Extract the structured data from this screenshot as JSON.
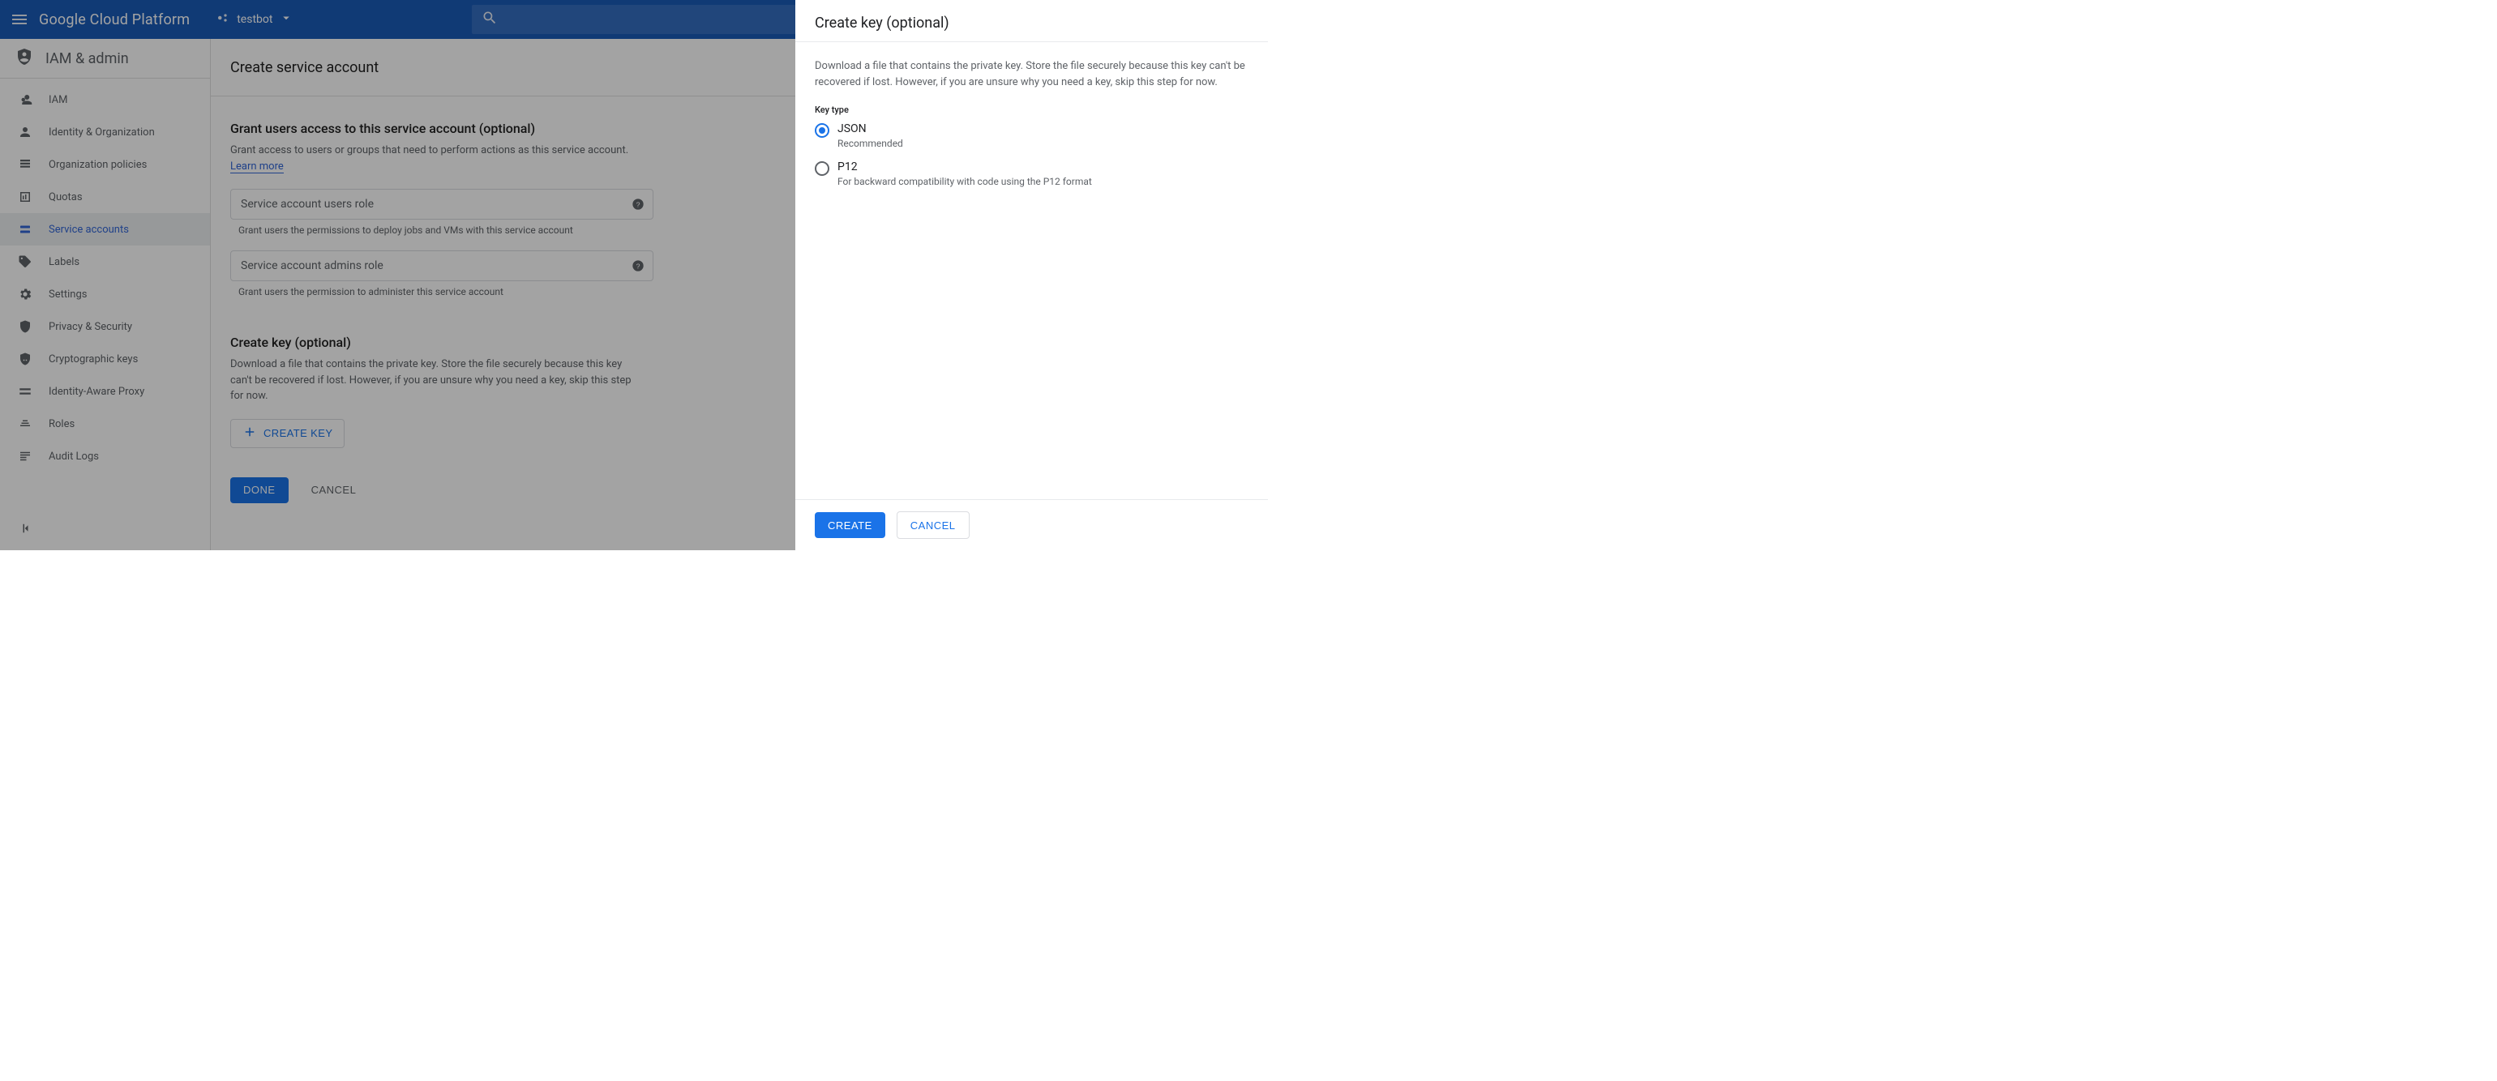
{
  "brand": "Google Cloud Platform",
  "project": {
    "name": "testbot"
  },
  "section": {
    "title": "IAM & admin"
  },
  "nav": {
    "items": [
      {
        "label": "IAM"
      },
      {
        "label": "Identity & Organization"
      },
      {
        "label": "Organization policies"
      },
      {
        "label": "Quotas"
      },
      {
        "label": "Service accounts"
      },
      {
        "label": "Labels"
      },
      {
        "label": "Settings"
      },
      {
        "label": "Privacy & Security"
      },
      {
        "label": "Cryptographic keys"
      },
      {
        "label": "Identity-Aware Proxy"
      },
      {
        "label": "Roles"
      },
      {
        "label": "Audit Logs"
      }
    ]
  },
  "page": {
    "title": "Create service account",
    "grant_title": "Grant users access to this service account (optional)",
    "grant_desc": "Grant access to users or groups that need to perform actions as this service account.",
    "learn_more": "Learn more",
    "users_role_placeholder": "Service account users role",
    "users_role_hint": "Grant users the permissions to deploy jobs and VMs with this service account",
    "admins_role_placeholder": "Service account admins role",
    "admins_role_hint": "Grant users the permission to administer this service account",
    "create_key_title": "Create key (optional)",
    "create_key_desc": "Download a file that contains the private key. Store the file securely because this key can't be recovered if lost. However, if you are unsure why you need a key, skip this step for now.",
    "create_key_btn": "CREATE KEY",
    "done_btn": "DONE",
    "cancel_btn": "CANCEL"
  },
  "drawer": {
    "title": "Create key (optional)",
    "desc": "Download a file that contains the private key. Store the file securely because this key can't be recovered if lost. However, if you are unsure why you need a key, skip this step for now.",
    "key_type_label": "Key type",
    "json_label": "JSON",
    "json_sub": "Recommended",
    "p12_label": "P12",
    "p12_sub": "For backward compatibility with code using the P12 format",
    "create_btn": "CREATE",
    "cancel_btn": "CANCEL"
  }
}
